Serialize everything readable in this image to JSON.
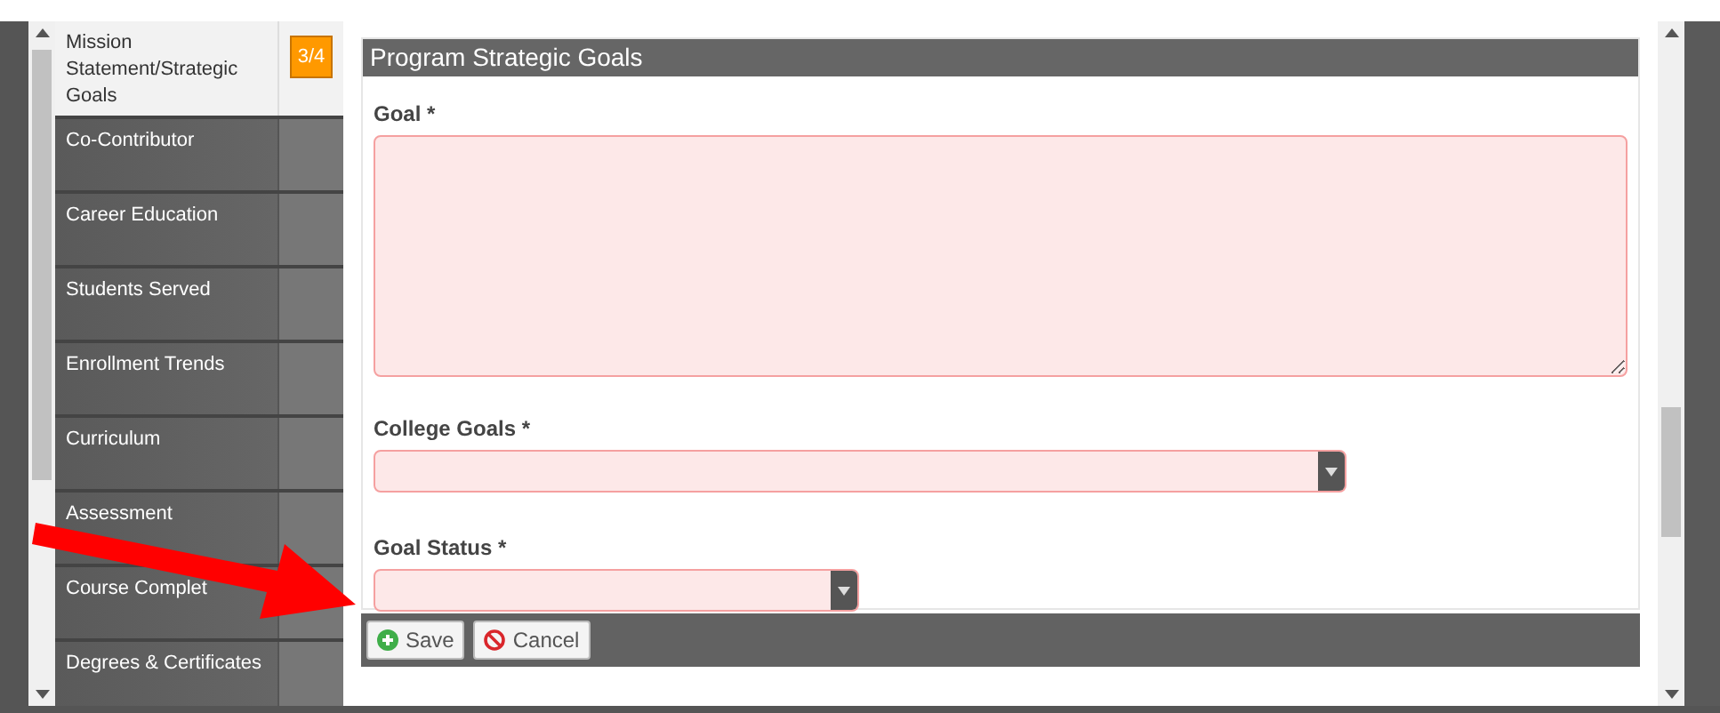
{
  "sidebar": {
    "items": [
      {
        "label": "Mission Statement/Strategic Goals",
        "selected": true,
        "badge": "3/4"
      },
      {
        "label": "Co-Contributor",
        "selected": false
      },
      {
        "label": "Career Education",
        "selected": false
      },
      {
        "label": "Students Served",
        "selected": false
      },
      {
        "label": "Enrollment Trends",
        "selected": false
      },
      {
        "label": "Curriculum",
        "selected": false
      },
      {
        "label": "Assessment",
        "selected": false
      },
      {
        "label": "Course Complet",
        "selected": false
      },
      {
        "label": "Degrees & Certificates",
        "selected": false
      }
    ]
  },
  "form": {
    "title": "Program Strategic Goals",
    "fields": [
      {
        "kind": "textarea",
        "label": "Goal *"
      },
      {
        "kind": "select",
        "label": "College Goals *"
      },
      {
        "kind": "select",
        "label": "Goal Status *"
      }
    ],
    "buttons": [
      {
        "kind": "save",
        "label": "Save"
      },
      {
        "kind": "cancel",
        "label": "Cancel"
      }
    ]
  }
}
